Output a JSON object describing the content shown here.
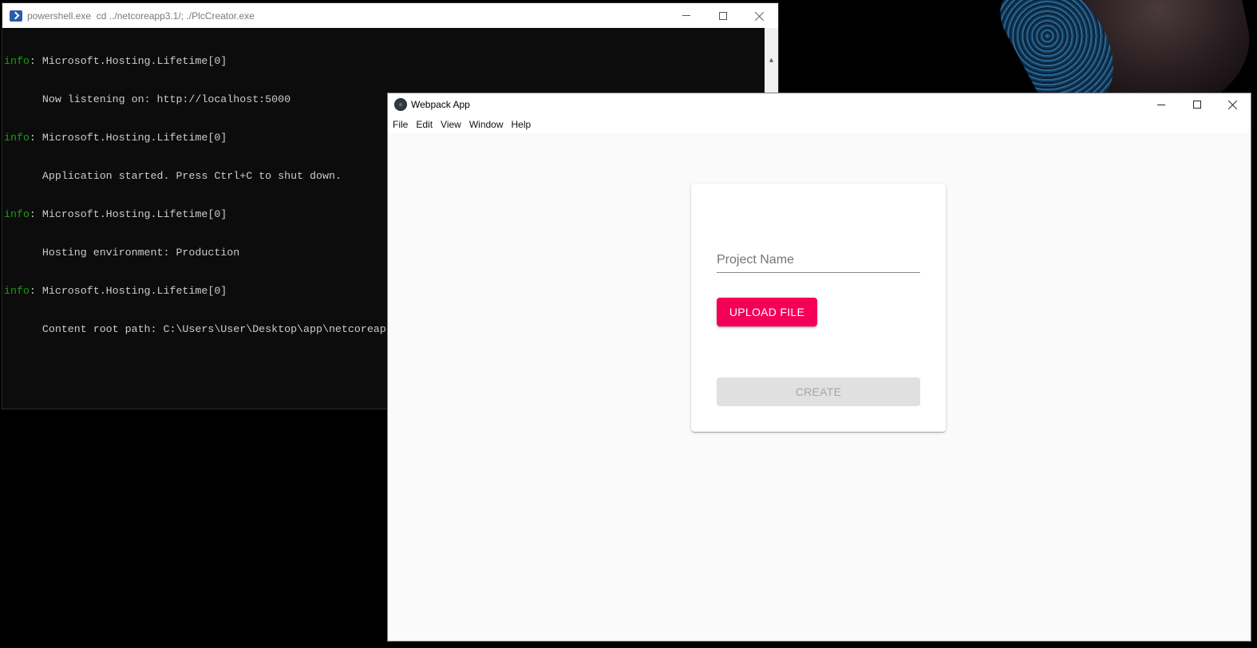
{
  "powershell": {
    "title": "powershell.exe  cd ../netcoreapp3.1/; ./PlcCreator.exe",
    "lines": [
      {
        "prefix": "info",
        "text": ": Microsoft.Hosting.Lifetime[0]"
      },
      {
        "prefix": "",
        "text": "      Now listening on: http://localhost:5000"
      },
      {
        "prefix": "info",
        "text": ": Microsoft.Hosting.Lifetime[0]"
      },
      {
        "prefix": "",
        "text": "      Application started. Press Ctrl+C to shut down."
      },
      {
        "prefix": "info",
        "text": ": Microsoft.Hosting.Lifetime[0]"
      },
      {
        "prefix": "",
        "text": "      Hosting environment: Production"
      },
      {
        "prefix": "info",
        "text": ": Microsoft.Hosting.Lifetime[0]"
      },
      {
        "prefix": "",
        "text": "      Content root path: C:\\Users\\User\\Desktop\\app\\netcoreapp"
      }
    ],
    "scroll_up_glyph": "▲",
    "icon": "powershell-icon"
  },
  "app": {
    "title": "Webpack App",
    "icon": "electron-icon",
    "menu": [
      "File",
      "Edit",
      "View",
      "Window",
      "Help"
    ],
    "form": {
      "project_name_value": "",
      "project_name_placeholder": "Project Name",
      "upload_label": "UPLOAD FILE",
      "create_label": "CREATE"
    }
  },
  "colors": {
    "upload_button": "#f50057",
    "create_button_disabled": "#e0e0e0",
    "terminal_bg": "#0c0c0c",
    "terminal_info": "#13a10e"
  }
}
